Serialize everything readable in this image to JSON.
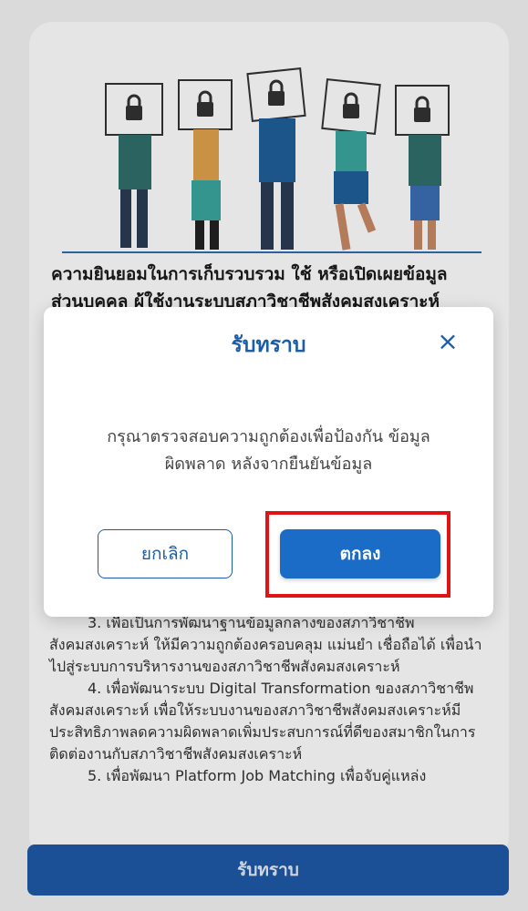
{
  "consent": {
    "title_line1": "ความยินยอมในการเก็บรวบรวม ใช้ หรือเปิดเผยข้อมูล",
    "title_line2": "ส่วนบุคคล ผู้ใช้งานระบบสภาวิชาชีพสังคมสงเคราะห์"
  },
  "body": {
    "paragraphs": [
      "3. เพื่อเป็นการพัฒนาฐานข้อมูลกลางของสภาวิชาชีพสังคมสงเคราะห์ ให้มีความถูกต้องครอบคลุม แม่นยำ เชื่อถือได้ เพื่อนำไปสู่ระบบการบริหารงานของสภาวิชาชีพสังคมสงเคราะห์",
      "4. เพื่อพัฒนาระบบ Digital Transformation ของสภาวิชาชีพสังคมสงเคราะห์ เพื่อให้ระบบงานของสภาวิชาชีพสังคมสงเคราะห์มีประสิทธิภาพลดความผิดพลาดเพิ่มประสบการณ์ที่ดีของสมาชิกในการติดต่องานกับสภาวิชาชีพสังคมสงเคราะห์",
      "5. เพื่อพัฒนา Platform Job Matching เพื่อจับคู่แหล่ง"
    ]
  },
  "bottom_button": {
    "label": "รับทราบ"
  },
  "modal": {
    "title": "รับทราบ",
    "message_line1": "กรุณาตรวจสอบความถูกต้องเพื่อป้องกัน ข้อมูล",
    "message_line2": "ผิดพลาด หลังจากยืนยันข้อมูล",
    "cancel_label": "ยกเลิก",
    "ok_label": "ตกลง"
  },
  "icons": {
    "close": "close-icon",
    "lock": "lock-icon"
  },
  "colors": {
    "primary": "#1a6cc6",
    "title_blue": "#1a5ea8",
    "highlight": "#e01414",
    "bottom_button": "#1f59a8"
  }
}
